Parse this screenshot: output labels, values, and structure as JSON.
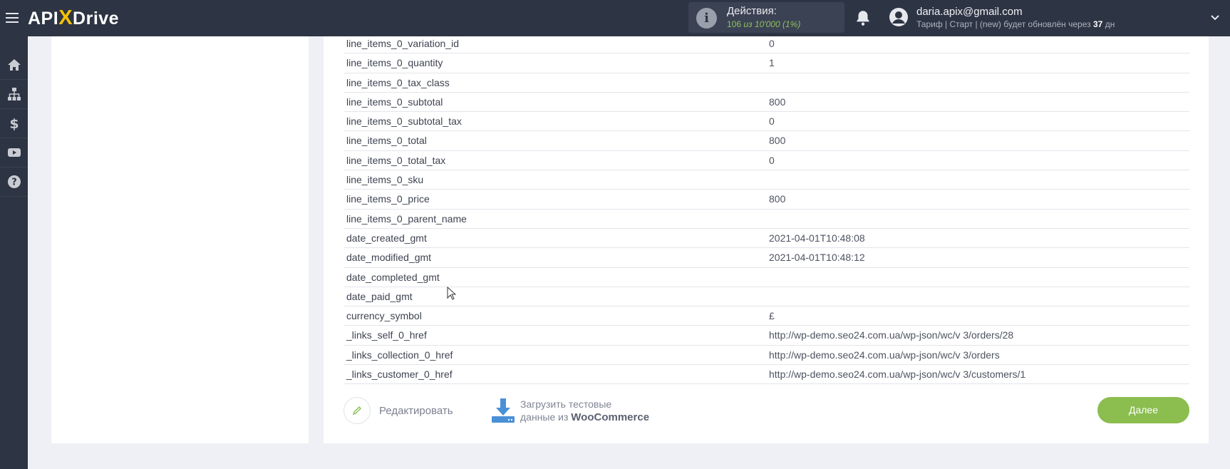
{
  "header": {
    "logo_prefix": "API",
    "logo_x": "X",
    "logo_suffix": "Drive",
    "actions_label": "Действия:",
    "actions_count": "106",
    "actions_sep": "из",
    "actions_total": "10'000",
    "actions_percent": "(1%)",
    "user_email": "daria.apix@gmail.com",
    "plan_text": "Тариф | Старт | (new) будет обновлён через",
    "plan_days": "37",
    "plan_days_unit": "дн"
  },
  "sidebar": {
    "items": [
      {
        "icon": "home-icon"
      },
      {
        "icon": "sitemap-icon"
      },
      {
        "icon": "dollar-icon"
      },
      {
        "icon": "youtube-icon"
      },
      {
        "icon": "help-icon"
      }
    ]
  },
  "table": {
    "rows": [
      {
        "key": "line_items_0_variation_id",
        "value": "0"
      },
      {
        "key": "line_items_0_quantity",
        "value": "1"
      },
      {
        "key": "line_items_0_tax_class",
        "value": ""
      },
      {
        "key": "line_items_0_subtotal",
        "value": "800"
      },
      {
        "key": "line_items_0_subtotal_tax",
        "value": "0"
      },
      {
        "key": "line_items_0_total",
        "value": "800"
      },
      {
        "key": "line_items_0_total_tax",
        "value": "0"
      },
      {
        "key": "line_items_0_sku",
        "value": ""
      },
      {
        "key": "line_items_0_price",
        "value": "800"
      },
      {
        "key": "line_items_0_parent_name",
        "value": ""
      },
      {
        "key": "date_created_gmt",
        "value": "2021-04-01T10:48:08"
      },
      {
        "key": "date_modified_gmt",
        "value": "2021-04-01T10:48:12"
      },
      {
        "key": "date_completed_gmt",
        "value": ""
      },
      {
        "key": "date_paid_gmt",
        "value": ""
      },
      {
        "key": "currency_symbol",
        "value": "£"
      },
      {
        "key": "_links_self_0_href",
        "value": "http://wp-demo.seo24.com.ua/wp-json/wc/v 3/orders/28"
      },
      {
        "key": "_links_collection_0_href",
        "value": "http://wp-demo.seo24.com.ua/wp-json/wc/v 3/orders"
      },
      {
        "key": "_links_customer_0_href",
        "value": "http://wp-demo.seo24.com.ua/wp-json/wc/v 3/customers/1"
      }
    ]
  },
  "footer": {
    "edit_label": "Редактировать",
    "load_line1": "Загрузить тестовые",
    "load_line2_prefix": "данные из",
    "load_line2_brand": "WooCommerce",
    "next_label": "Далее"
  },
  "colors": {
    "topbar": "#2d3443",
    "accent_green": "#8bbd4f",
    "logo_yellow": "#f5c200",
    "download_blue": "#4a90d9"
  }
}
